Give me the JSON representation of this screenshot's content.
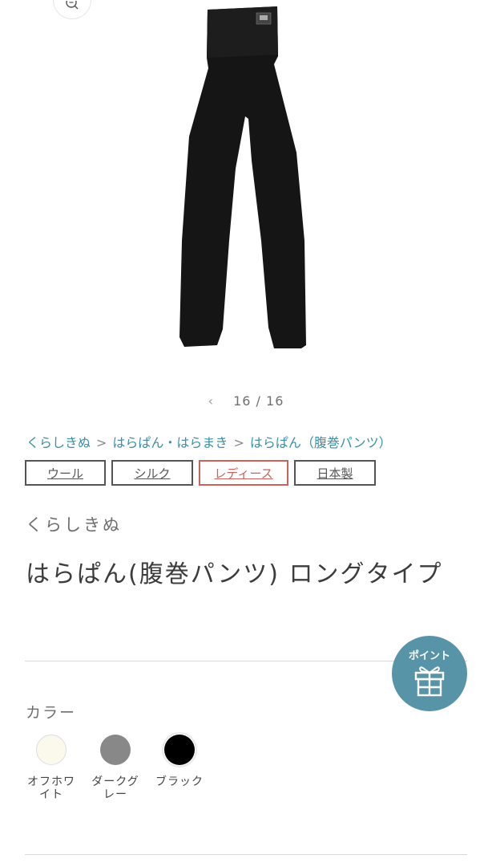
{
  "gallery": {
    "zoom_icon": "zoom-in-icon",
    "pager": {
      "prev_icon": "chevron-left-icon",
      "current": "16",
      "separator": "/",
      "total": "16"
    }
  },
  "breadcrumb": {
    "items": [
      "くらしきぬ",
      "はらぱん・はらまき",
      "はらぱん（腹巻パンツ）"
    ],
    "separator": ">"
  },
  "tags": [
    "ウール",
    "シルク",
    "レディース",
    "日本製"
  ],
  "product": {
    "vendor": "くらしきぬ",
    "title": "はらぱん(腹巻パンツ) ロングタイプ"
  },
  "point_badge": {
    "label": "ポイント",
    "icon": "gift-icon",
    "color": "#5894a8"
  },
  "colors": {
    "label": "カラー",
    "options": [
      {
        "name": "オフホワイト",
        "hex": "#fbf8ec",
        "selected": false
      },
      {
        "name": "ダークグレー",
        "hex": "#888888",
        "selected": false
      },
      {
        "name": "ブラック",
        "hex": "#000000",
        "selected": true
      }
    ]
  },
  "colors_theme": {
    "link": "#3b8fa6",
    "tag_red": "#c9625a"
  }
}
